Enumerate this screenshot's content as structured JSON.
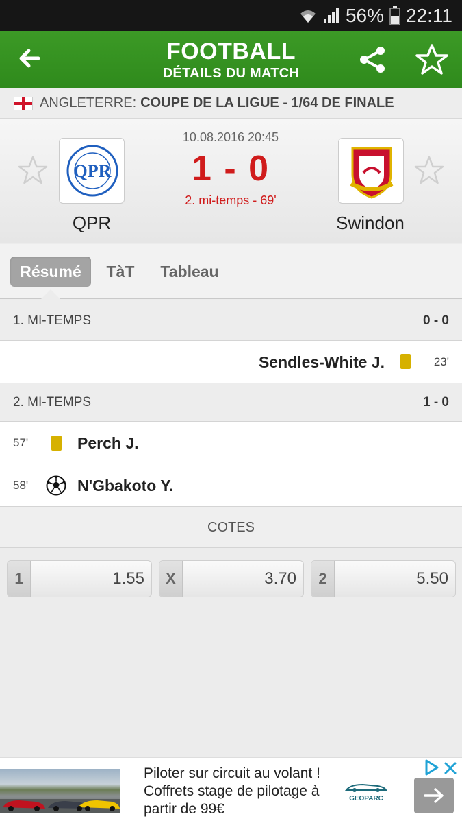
{
  "status_bar": {
    "battery": "56%",
    "time": "22:11"
  },
  "header": {
    "title": "FOOTBALL",
    "subtitle": "DÉTAILS DU MATCH"
  },
  "league": {
    "country": "ANGLETERRE:",
    "competition": "COUPE DE LA LIGUE - 1/64 DE FINALE"
  },
  "match": {
    "datetime": "10.08.2016 20:45",
    "score": "1 - 0",
    "period": "2. mi-temps - 69'",
    "home": {
      "name": "QPR"
    },
    "away": {
      "name": "Swindon"
    }
  },
  "tabs": [
    {
      "label": "Résumé",
      "active": true
    },
    {
      "label": "TàT",
      "active": false
    },
    {
      "label": "Tableau",
      "active": false
    }
  ],
  "sections": [
    {
      "label": "1. MI-TEMPS",
      "score": "0 - 0",
      "events": [
        {
          "side": "away",
          "minute": "23'",
          "player": "Sendles-White J.",
          "type": "yellow-card"
        }
      ]
    },
    {
      "label": "2. MI-TEMPS",
      "score": "1 - 0",
      "events": [
        {
          "side": "home",
          "minute": "57'",
          "player": "Perch J.",
          "type": "yellow-card"
        },
        {
          "side": "home",
          "minute": "58'",
          "player": "N'Gbakoto Y.",
          "type": "goal"
        }
      ]
    }
  ],
  "odds": {
    "title": "COTES",
    "items": [
      {
        "label": "1",
        "value": "1.55"
      },
      {
        "label": "X",
        "value": "3.70"
      },
      {
        "label": "2",
        "value": "5.50"
      }
    ]
  },
  "ad": {
    "text": "Piloter sur circuit au volant ! Coffrets stage de pilotage à partir de 99€",
    "brand": "GEOPARC"
  },
  "colors": {
    "accent_green": "#2f8a1c",
    "score_red": "#d01c1c",
    "yellow_card": "#d6b100"
  },
  "icons": [
    "wifi-icon",
    "signal-icon",
    "battery-icon",
    "back-arrow-icon",
    "share-icon",
    "star-icon",
    "england-flag-icon",
    "soccer-ball-icon",
    "arrow-right-icon",
    "adchoices-icon"
  ]
}
